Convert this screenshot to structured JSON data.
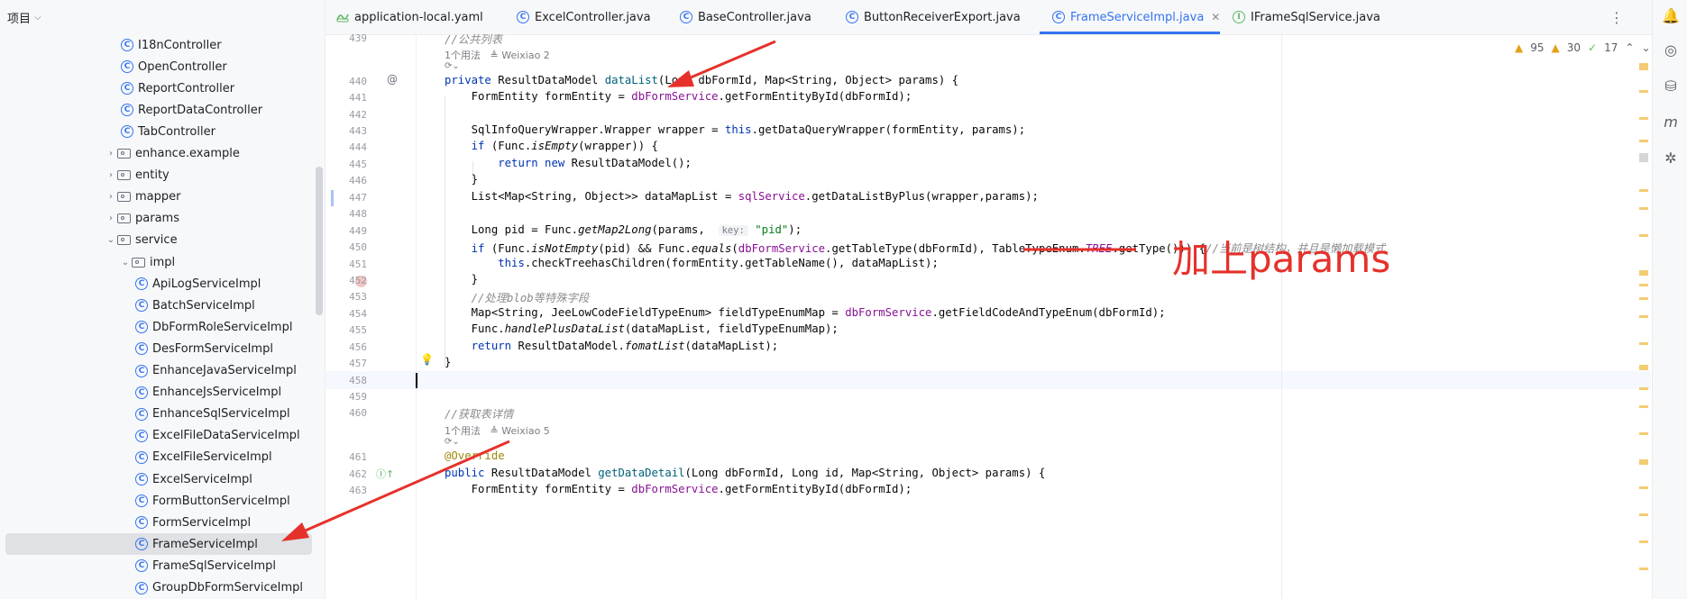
{
  "project_panel": {
    "title": "项目",
    "tree": [
      {
        "label": "I18nController",
        "kind": "class",
        "indent": 2
      },
      {
        "label": "OpenController",
        "kind": "class",
        "indent": 2
      },
      {
        "label": "ReportController",
        "kind": "class",
        "indent": 2
      },
      {
        "label": "ReportDataController",
        "kind": "class",
        "indent": 2
      },
      {
        "label": "TabController",
        "kind": "class",
        "indent": 2
      },
      {
        "label": "enhance.example",
        "kind": "package",
        "indent": 1,
        "expanded": false
      },
      {
        "label": "entity",
        "kind": "package",
        "indent": 1,
        "expanded": false
      },
      {
        "label": "mapper",
        "kind": "package",
        "indent": 1,
        "expanded": false
      },
      {
        "label": "params",
        "kind": "package",
        "indent": 1,
        "expanded": false
      },
      {
        "label": "service",
        "kind": "package",
        "indent": 1,
        "expanded": true
      },
      {
        "label": "impl",
        "kind": "package",
        "indent": 2,
        "expanded": true
      },
      {
        "label": "ApiLogServiceImpl",
        "kind": "class",
        "indent": 3
      },
      {
        "label": "BatchServiceImpl",
        "kind": "class",
        "indent": 3
      },
      {
        "label": "DbFormRoleServiceImpl",
        "kind": "class",
        "indent": 3
      },
      {
        "label": "DesFormServiceImpl",
        "kind": "class",
        "indent": 3
      },
      {
        "label": "EnhanceJavaServiceImpl",
        "kind": "class",
        "indent": 3
      },
      {
        "label": "EnhanceJsServiceImpl",
        "kind": "class",
        "indent": 3
      },
      {
        "label": "EnhanceSqlServiceImpl",
        "kind": "class",
        "indent": 3
      },
      {
        "label": "ExcelFileDataServiceImpl",
        "kind": "class",
        "indent": 3
      },
      {
        "label": "ExcelFileServiceImpl",
        "kind": "class",
        "indent": 3
      },
      {
        "label": "ExcelServiceImpl",
        "kind": "class",
        "indent": 3
      },
      {
        "label": "FormButtonServiceImpl",
        "kind": "class",
        "indent": 3
      },
      {
        "label": "FormServiceImpl",
        "kind": "class",
        "indent": 3
      },
      {
        "label": "FrameServiceImpl",
        "kind": "class",
        "indent": 3,
        "selected": true
      },
      {
        "label": "FrameSqlServiceImpl",
        "kind": "class",
        "indent": 3
      },
      {
        "label": "GroupDbFormServiceImpl",
        "kind": "class",
        "indent": 3
      }
    ]
  },
  "tabs": [
    {
      "label": "application-local.yaml",
      "icon": "yaml-icon",
      "active": false
    },
    {
      "label": "ExcelController.java",
      "icon": "class-icon",
      "active": false
    },
    {
      "label": "BaseController.java",
      "icon": "class-icon",
      "active": false
    },
    {
      "label": "ButtonReceiverExport.java",
      "icon": "class-icon",
      "active": false
    },
    {
      "label": "FrameServiceImpl.java",
      "icon": "class-icon",
      "active": true
    },
    {
      "label": "IFrameSqlService.java",
      "icon": "interface-icon",
      "active": false
    }
  ],
  "inspections": {
    "warnings": "95",
    "weak_warnings": "30",
    "ok": "17"
  },
  "editor": {
    "usage_hint_1": "1个用法",
    "author_hint_1": "Weixiao 2",
    "usage_hint_2": "1个用法",
    "author_hint_2": "Weixiao 5",
    "param_hint_key": "key:",
    "line_numbers": [
      "439",
      "440",
      "441",
      "442",
      "443",
      "444",
      "445",
      "446",
      "447",
      "448",
      "449",
      "450",
      "451",
      "452",
      "453",
      "454",
      "455",
      "456",
      "457",
      "458",
      "459",
      "460",
      "461",
      "462",
      "463"
    ],
    "comments": {
      "c439": "//公共列表",
      "c450": "//当前是树结构，并且是懒加载模式",
      "c453": "//处理blob等特殊字段",
      "c460": "//获取表详情"
    }
  },
  "annotation": {
    "text": "加上params",
    "color": "#e6312b"
  }
}
